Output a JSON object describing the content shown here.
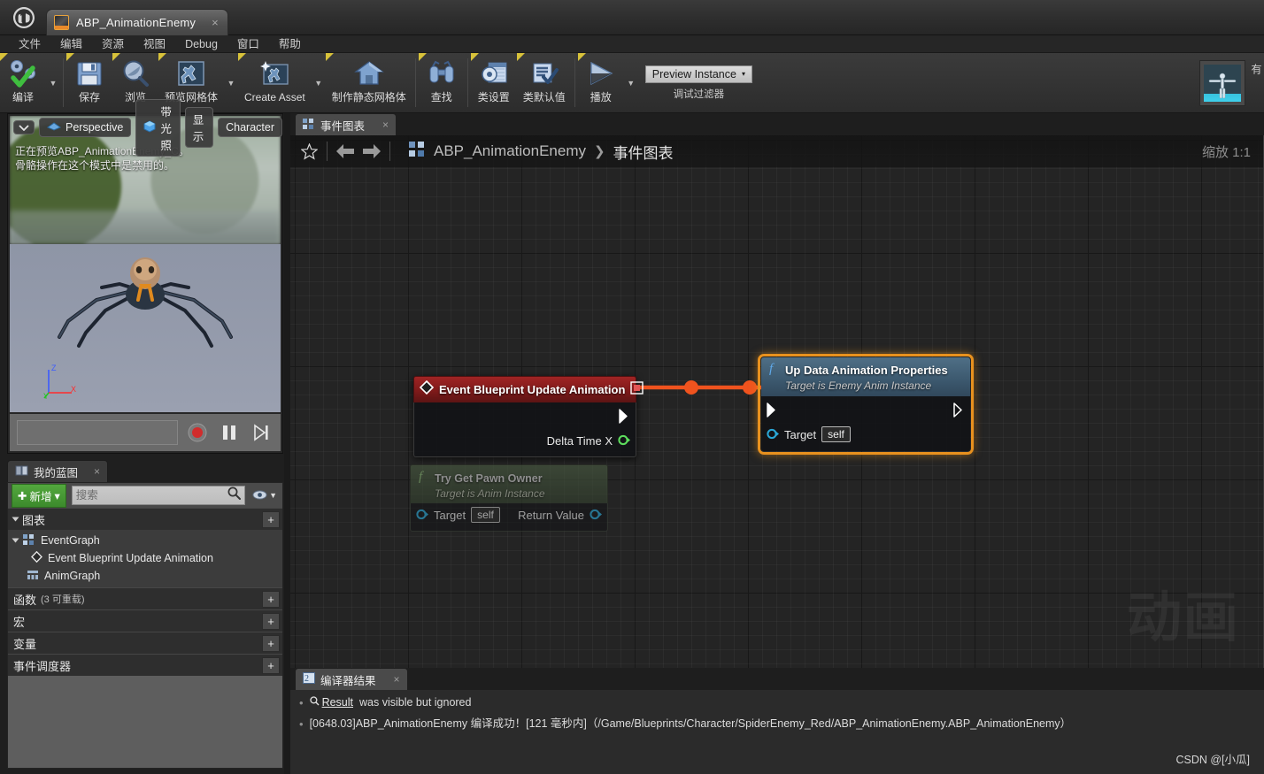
{
  "titlebar": {
    "logo": "ue-logo",
    "tab_label": "ABP_AnimationEnemy",
    "tab_close": "×"
  },
  "menubar": {
    "items": [
      {
        "label": "文件"
      },
      {
        "label": "编辑"
      },
      {
        "label": "资源"
      },
      {
        "label": "视图"
      },
      {
        "label": "Debug"
      },
      {
        "label": "窗口"
      },
      {
        "label": "帮助"
      }
    ]
  },
  "toolbar": {
    "compile": "编译",
    "save": "保存",
    "browse": "浏览",
    "preview_mesh": "预览网格体",
    "create_asset": "Create Asset",
    "make_static_mesh": "制作静态网格体",
    "find": "查找",
    "class_settings": "类设置",
    "class_defaults": "类默认值",
    "play": "播放",
    "debug_filter_value": "Preview Instance",
    "debug_filter_caret": "▾",
    "debug_filter_label": "调试过滤器"
  },
  "viewport": {
    "view_mode": "Perspective",
    "lit_mode": "带光照",
    "show": "显示",
    "character": "Character",
    "overlay_line1": "正在预览ABP_AnimationEnemy_C。",
    "overlay_line2": "骨骼操作在这个模式中是禁用的。",
    "axis_x": "X",
    "axis_y": "Y",
    "axis_z": "Z"
  },
  "my_blueprint": {
    "tab_label": "我的蓝图",
    "tab_close": "×",
    "add_button": "新增",
    "add_caret": "▾",
    "search_placeholder": "搜索",
    "search_value": "",
    "sections": [
      {
        "label": "图表",
        "sub": "",
        "plus": "+"
      },
      {
        "label": "函数",
        "sub": "(3 可重载)",
        "plus": "+"
      },
      {
        "label": "宏",
        "sub": "",
        "plus": "+"
      },
      {
        "label": "变量",
        "sub": "",
        "plus": "+"
      },
      {
        "label": "事件调度器",
        "sub": "",
        "plus": "+"
      }
    ],
    "graph_tree": [
      {
        "label": "EventGraph",
        "icon": "graph-icon",
        "indent": 0
      },
      {
        "label": "Event Blueprint Update Animation",
        "icon": "event-diamond-icon",
        "indent": 1
      },
      {
        "label": "AnimGraph",
        "icon": "animgraph-icon",
        "indent": 0
      }
    ]
  },
  "graph": {
    "tab_label": "事件图表",
    "tab_close": "×",
    "breadcrumb_root": "ABP_AnimationEnemy",
    "breadcrumb_sep": "❯",
    "breadcrumb_current": "事件图表",
    "zoom_label": "缩放 1:1",
    "watermark": "动画",
    "nodes": [
      {
        "id": "event-blueprint-update-animation",
        "title": "Event Blueprint Update Animation",
        "subtitle": "",
        "out_data_pin": "Delta Time X",
        "header_color": "#8a1e1e"
      },
      {
        "id": "up-data-animation-properties",
        "title": "Up Data Animation Properties",
        "subtitle": "Target is Enemy Anim Instance",
        "target_label": "Target",
        "target_value": "self",
        "header_color": "#3d5a70",
        "selected": true,
        "selection_color": "#e8911e"
      },
      {
        "id": "try-get-pawn-owner",
        "title": "Try Get Pawn Owner",
        "subtitle": "Target is Anim Instance",
        "target_label": "Target",
        "target_value": "self",
        "return_label": "Return Value",
        "header_color": "#3c4b36"
      }
    ],
    "wire_color": "#f0531e"
  },
  "results": {
    "tab_label": "编译器结果",
    "tab_close": "×",
    "lines": [
      {
        "bullet": "•",
        "link": "Result",
        "text": "was visible but ignored"
      },
      {
        "bullet": "•",
        "link": "",
        "text": "[0648.03]ABP_AnimationEnemy 编译成功！[121 毫秒内]（/Game/Blueprints/Character/SpiderEnemy_Red/ABP_AnimationEnemy.ABP_AnimationEnemy）"
      }
    ]
  },
  "watermark_credit": "CSDN @[小瓜]"
}
